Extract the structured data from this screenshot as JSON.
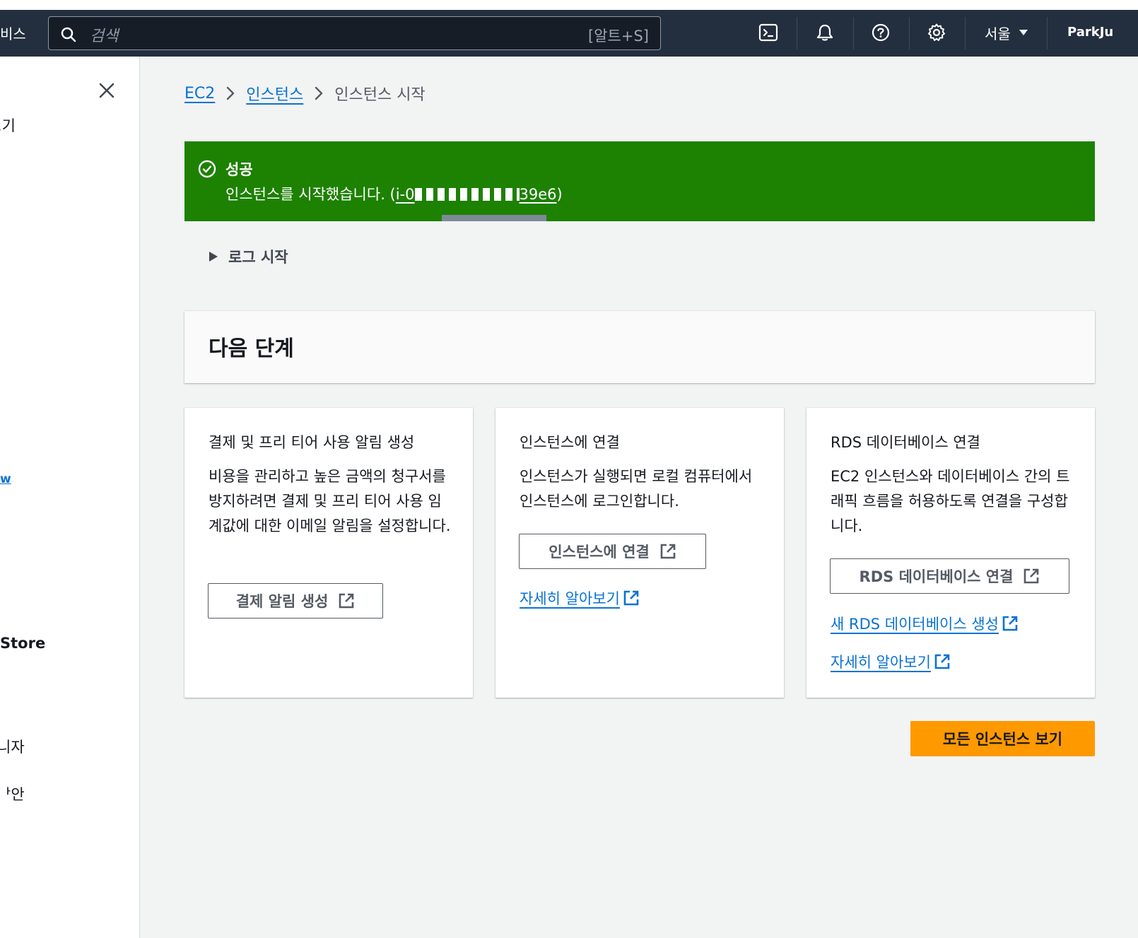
{
  "topnav": {
    "services_label": "비스",
    "search_placeholder": "검색",
    "search_shortcut": "[알트+S]",
    "region": "서울",
    "account": "ParkJu"
  },
  "sidebar": {
    "items": [
      {
        "label": ".기"
      },
      {
        "label": "w"
      },
      {
        "label": "Store"
      },
      {
        "label": "니자"
      },
      {
        "label": "ᅡ안"
      }
    ]
  },
  "breadcrumb": {
    "items": [
      {
        "label": "EC2"
      },
      {
        "label": "인스턴스"
      },
      {
        "label": "인스턴스 시작"
      }
    ]
  },
  "flash": {
    "title": "성공",
    "message": "인스턴스를 시작했습니다. (",
    "instance_id_start": "i-0",
    "instance_id_end": "39e6",
    "message_end": ")",
    "color": "#1d8102"
  },
  "logs": {
    "label": "로그 시작"
  },
  "next_steps": {
    "title": "다음 단계",
    "cards": [
      {
        "title": "결제 및 프리 티어 사용 알림 생성",
        "description": "비용을 관리하고 높은 금액의 청구서를 방지하려면 결제 및 프리 티어 사용 임계값에 대한 이메일 알림을 설정합니다.",
        "button": "결제 알림 생성"
      },
      {
        "title": "인스턴스에 연결",
        "description": "인스턴스가 실행되면 로컬 컴퓨터에서 인스턴스에 로그인합니다.",
        "button": "인스턴스에 연결",
        "links": [
          "자세히 알아보기"
        ]
      },
      {
        "title": "RDS 데이터베이스 연결",
        "description": "EC2 인스턴스와 데이터베이스 간의 트래픽 흐름을 허용하도록 연결을 구성합니다.",
        "button": "RDS 데이터베이스 연결",
        "links": [
          "새 RDS 데이터베이스 생성",
          "자세히 알아보기"
        ]
      }
    ]
  },
  "primary_action": {
    "label": "모든 인스턴스 보기",
    "color": "#ff9900"
  },
  "icons": [
    "search-icon",
    "cloudshell-icon",
    "bell-icon",
    "help-icon",
    "gear-icon",
    "close-icon",
    "check-circle-icon",
    "external-link-icon"
  ]
}
